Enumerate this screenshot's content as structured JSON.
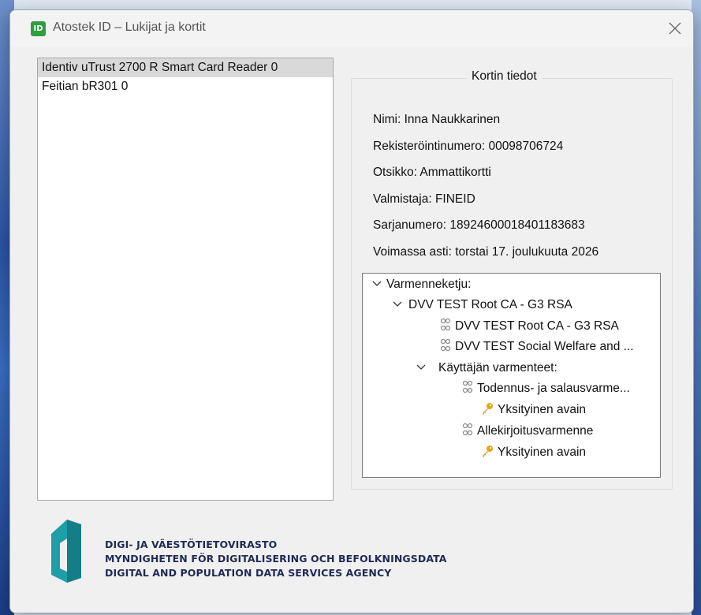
{
  "window": {
    "title": "Atostek ID – Lukijat ja kortit",
    "app_icon_text": "ID"
  },
  "readers": [
    {
      "label": "Identiv uTrust 2700 R Smart Card Reader 0",
      "selected": true
    },
    {
      "label": "Feitian bR301 0",
      "selected": false
    }
  ],
  "card_info": {
    "legend": "Kortin tiedot",
    "lines": [
      "Nimi: Inna Naukkarinen",
      "Rekisteröintinumero: 00098706724",
      "Otsikko: Ammattikortti",
      "Valmistaja: FINEID",
      "Sarjanumero: 18924600018401183683",
      "Voimassa asti: torstai 17. joulukuuta 2026"
    ]
  },
  "cert_tree": {
    "root": "Varmenneketju:",
    "ca": "DVV TEST Root CA - G3 RSA",
    "ca_cert": "DVV TEST Root CA - G3 RSA",
    "sub_ca": "DVV TEST Social Welfare and ...",
    "user_certs": "Käyttäjän varmenteet:",
    "auth_cert": "Todennus- ja salausvarme...",
    "auth_key": "Yksityinen avain",
    "sign_cert": "Allekirjoitusvarmenne",
    "sign_key": "Yksityinen avain"
  },
  "footer": {
    "line1": "DIGI- JA VÄESTÖTIETOVIRASTO",
    "line2": "MYNDIGHETEN FÖR DIGITALISERING OCH BEFOLKNINGSDATA",
    "line3": "DIGITAL AND POPULATION DATA SERVICES AGENCY"
  },
  "colors": {
    "app_icon": "#2f9e3f",
    "logo_teal": "#1f9ea8",
    "logo_text": "#1f2a55",
    "key_icon": "#e8a317"
  }
}
